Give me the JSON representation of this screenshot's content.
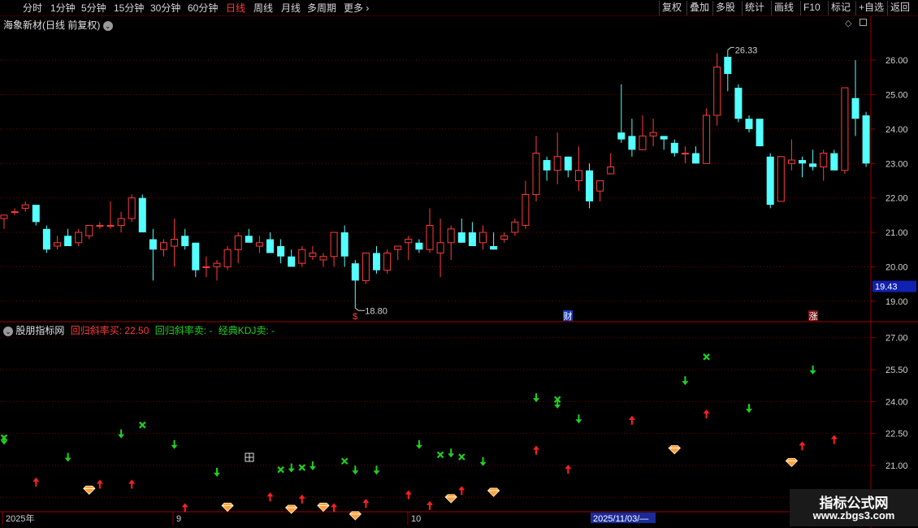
{
  "toolbar": {
    "periods": [
      "分时",
      "1分钟",
      "5分钟",
      "15分钟",
      "30分钟",
      "60分钟",
      "日线",
      "周线",
      "月线",
      "多周期"
    ],
    "active_period": "日线",
    "more": "更多",
    "right_buttons": [
      "复权",
      "叠加",
      "多股",
      "统计",
      "画线",
      "F10",
      "标记",
      "+自选",
      "返回"
    ]
  },
  "main_panel": {
    "title": "海象新材(日线 前复权)",
    "price_axis": [
      "26.00",
      "25.00",
      "24.00",
      "23.00",
      "22.00",
      "21.00",
      "20.00",
      "19.00"
    ],
    "current_price_tag": "19.43",
    "high_label": "26.33",
    "low_label": "18.80",
    "event_markers": [
      "$",
      "财",
      "涨"
    ]
  },
  "indicator_panel": {
    "title": "股朋指标网",
    "label_buy": "回归斜率买: 22.50",
    "label_sell": "回归斜率卖: -",
    "label_kdj": "经典KDJ卖: -",
    "axis": [
      "27.00",
      "25.50",
      "24.00",
      "22.50",
      "21.00",
      "19.50"
    ]
  },
  "date_axis": {
    "labels": [
      "2025年",
      "9",
      "10"
    ],
    "cursor_date": "2025/11/03/—"
  },
  "watermark": {
    "title": "指标公式网",
    "url": "www.zbgs3.com"
  },
  "colors": {
    "up": "#ff3c3c",
    "down": "#54ffff",
    "grid": "#7a0000",
    "buy_arrow": "#ff2020",
    "sell_arrow": "#20d020",
    "diamond": "#ffa040"
  },
  "chart_data": {
    "type": "candlestick",
    "series": [
      {
        "ohlc": [
          [
            21.4,
            21.5,
            21.1,
            21.5
          ],
          [
            21.6,
            21.7,
            21.5,
            21.6
          ],
          [
            21.7,
            21.9,
            21.6,
            21.8
          ],
          [
            21.8,
            21.8,
            21.2,
            21.3
          ],
          [
            21.1,
            21.2,
            20.4,
            20.5
          ],
          [
            20.6,
            20.9,
            20.5,
            20.7
          ],
          [
            20.9,
            21.1,
            20.6,
            20.6
          ],
          [
            20.7,
            21.1,
            20.6,
            21.0
          ],
          [
            20.9,
            21.2,
            20.8,
            21.2
          ],
          [
            21.2,
            21.3,
            21.1,
            21.2
          ],
          [
            21.2,
            21.9,
            21.1,
            21.2
          ],
          [
            21.2,
            21.6,
            21.0,
            21.4
          ],
          [
            21.4,
            22.1,
            21.3,
            22.0
          ],
          [
            22.0,
            22.1,
            21.0,
            21.0
          ],
          [
            20.8,
            21.1,
            19.6,
            20.5
          ],
          [
            20.5,
            20.8,
            20.3,
            20.7
          ],
          [
            20.6,
            21.4,
            20.0,
            20.8
          ],
          [
            20.9,
            21.1,
            20.5,
            20.6
          ],
          [
            20.7,
            20.7,
            19.7,
            19.9
          ],
          [
            20.0,
            20.3,
            19.7,
            20.0
          ],
          [
            20.0,
            20.2,
            19.6,
            20.1
          ],
          [
            20.0,
            20.6,
            19.9,
            20.5
          ],
          [
            20.5,
            21.0,
            20.1,
            20.9
          ],
          [
            20.9,
            21.1,
            20.8,
            20.7
          ],
          [
            20.6,
            20.9,
            20.4,
            20.7
          ],
          [
            20.8,
            21.0,
            20.4,
            20.4
          ],
          [
            20.6,
            20.8,
            20.1,
            20.3
          ],
          [
            20.3,
            20.5,
            20.0,
            20.0
          ],
          [
            20.1,
            20.6,
            20.0,
            20.5
          ],
          [
            20.3,
            20.6,
            20.2,
            20.4
          ],
          [
            20.2,
            20.4,
            20.0,
            20.3
          ],
          [
            20.3,
            21.0,
            20.0,
            21.0
          ],
          [
            21.0,
            21.2,
            20.0,
            20.3
          ],
          [
            20.1,
            20.2,
            18.8,
            19.6
          ],
          [
            19.6,
            20.4,
            19.5,
            20.4
          ],
          [
            20.4,
            20.6,
            19.8,
            19.9
          ],
          [
            19.9,
            20.5,
            19.8,
            20.4
          ],
          [
            20.5,
            20.6,
            20.2,
            20.6
          ],
          [
            20.7,
            20.9,
            20.2,
            20.8
          ],
          [
            20.7,
            20.8,
            20.4,
            20.5
          ],
          [
            20.5,
            21.7,
            20.4,
            21.2
          ],
          [
            20.4,
            21.4,
            19.7,
            20.7
          ],
          [
            20.7,
            21.2,
            20.2,
            21.1
          ],
          [
            21.0,
            21.4,
            20.7,
            20.7
          ],
          [
            21.0,
            21.3,
            20.6,
            20.6
          ],
          [
            20.7,
            21.2,
            20.5,
            21.0
          ],
          [
            20.6,
            21.0,
            20.5,
            20.5
          ],
          [
            20.8,
            21.0,
            20.7,
            20.9
          ],
          [
            21.0,
            21.4,
            20.9,
            21.3
          ],
          [
            21.2,
            22.5,
            21.1,
            22.1
          ],
          [
            22.1,
            23.8,
            21.9,
            23.3
          ],
          [
            23.1,
            23.2,
            22.5,
            22.8
          ],
          [
            22.8,
            23.9,
            22.4,
            23.2
          ],
          [
            23.2,
            23.2,
            22.6,
            22.8
          ],
          [
            22.5,
            23.5,
            22.2,
            22.8
          ],
          [
            22.8,
            23.0,
            21.7,
            21.9
          ],
          [
            22.2,
            22.5,
            21.9,
            22.5
          ],
          [
            22.7,
            23.3,
            22.7,
            22.9
          ],
          [
            23.9,
            25.3,
            23.6,
            23.7
          ],
          [
            23.8,
            24.3,
            23.2,
            23.4
          ],
          [
            23.4,
            24.4,
            23.4,
            23.8
          ],
          [
            23.8,
            24.3,
            23.5,
            23.9
          ],
          [
            23.8,
            23.8,
            23.4,
            23.7
          ],
          [
            23.6,
            23.7,
            23.2,
            23.3
          ],
          [
            23.3,
            23.5,
            23.0,
            23.3
          ],
          [
            23.3,
            23.5,
            23.0,
            23.0
          ],
          [
            23.0,
            24.6,
            23.0,
            24.4
          ],
          [
            24.4,
            26.2,
            24.1,
            25.8
          ],
          [
            26.1,
            26.3,
            25.1,
            25.6
          ],
          [
            25.2,
            25.3,
            24.2,
            24.3
          ],
          [
            24.3,
            24.4,
            23.9,
            24.0
          ],
          [
            24.3,
            24.3,
            23.5,
            23.5
          ],
          [
            23.2,
            23.3,
            21.7,
            21.8
          ],
          [
            21.9,
            23.1,
            21.9,
            23.2
          ],
          [
            23.0,
            23.7,
            22.8,
            23.1
          ],
          [
            23.1,
            23.2,
            22.6,
            23.0
          ],
          [
            23.0,
            23.4,
            22.8,
            22.9
          ],
          [
            22.9,
            23.4,
            22.5,
            23.3
          ],
          [
            23.3,
            23.4,
            22.8,
            22.8
          ],
          [
            22.8,
            25.2,
            22.7,
            25.2
          ],
          [
            24.9,
            26.0,
            23.8,
            24.3
          ],
          [
            24.4,
            24.5,
            22.9,
            23.0
          ]
        ]
      }
    ],
    "ylim": [
      18.5,
      26.9
    ],
    "indicator_ylim": [
      18.9,
      27.6
    ],
    "indicator_signals": [
      {
        "i": 0,
        "type": "cross",
        "v": 22.3
      },
      {
        "i": 0,
        "type": "sell",
        "v": 22.2
      },
      {
        "i": 3,
        "type": "buy",
        "v": 20.2
      },
      {
        "i": 6,
        "type": "sell",
        "v": 21.4
      },
      {
        "i": 8,
        "type": "diamond",
        "v": 19.8
      },
      {
        "i": 9,
        "type": "buy",
        "v": 20.1
      },
      {
        "i": 11,
        "type": "sell",
        "v": 22.5
      },
      {
        "i": 12,
        "type": "buy",
        "v": 20.1
      },
      {
        "i": 13,
        "type": "cross",
        "v": 22.9
      },
      {
        "i": 16,
        "type": "sell",
        "v": 22.0
      },
      {
        "i": 17,
        "type": "buy",
        "v": 19.0
      },
      {
        "i": 20,
        "type": "sell",
        "v": 20.7
      },
      {
        "i": 21,
        "type": "diamond",
        "v": 19.0
      },
      {
        "i": 25,
        "type": "buy",
        "v": 19.5
      },
      {
        "i": 26,
        "type": "cross",
        "v": 20.8
      },
      {
        "i": 27,
        "type": "sell",
        "v": 20.9
      },
      {
        "i": 27,
        "type": "diamond",
        "v": 18.9
      },
      {
        "i": 28,
        "type": "buy",
        "v": 19.4
      },
      {
        "i": 28,
        "type": "cross",
        "v": 20.9
      },
      {
        "i": 29,
        "type": "sell",
        "v": 21.0
      },
      {
        "i": 30,
        "type": "diamond",
        "v": 19.0
      },
      {
        "i": 31,
        "type": "buy",
        "v": 19.0
      },
      {
        "i": 32,
        "type": "cross",
        "v": 21.2
      },
      {
        "i": 33,
        "type": "sell",
        "v": 20.8
      },
      {
        "i": 33,
        "type": "diamond",
        "v": 18.6
      },
      {
        "i": 34,
        "type": "buy",
        "v": 19.2
      },
      {
        "i": 35,
        "type": "sell",
        "v": 20.8
      },
      {
        "i": 38,
        "type": "buy",
        "v": 19.6
      },
      {
        "i": 39,
        "type": "sell",
        "v": 22.0
      },
      {
        "i": 40,
        "type": "buy",
        "v": 19.1
      },
      {
        "i": 41,
        "type": "cross",
        "v": 21.5
      },
      {
        "i": 42,
        "type": "diamond",
        "v": 19.4
      },
      {
        "i": 42,
        "type": "sell",
        "v": 21.6
      },
      {
        "i": 43,
        "type": "cross",
        "v": 21.4
      },
      {
        "i": 43,
        "type": "buy",
        "v": 19.8
      },
      {
        "i": 45,
        "type": "sell",
        "v": 21.2
      },
      {
        "i": 46,
        "type": "diamond",
        "v": 19.7
      },
      {
        "i": 50,
        "type": "buy",
        "v": 21.7
      },
      {
        "i": 50,
        "type": "sell",
        "v": 24.2
      },
      {
        "i": 52,
        "type": "cross",
        "v": 24.1
      },
      {
        "i": 52,
        "type": "sell",
        "v": 23.9
      },
      {
        "i": 53,
        "type": "buy",
        "v": 20.8
      },
      {
        "i": 54,
        "type": "sell",
        "v": 23.2
      },
      {
        "i": 59,
        "type": "buy",
        "v": 23.1
      },
      {
        "i": 63,
        "type": "diamond",
        "v": 21.7
      },
      {
        "i": 64,
        "type": "sell",
        "v": 25.0
      },
      {
        "i": 66,
        "type": "cross",
        "v": 26.1
      },
      {
        "i": 66,
        "type": "buy",
        "v": 23.4
      },
      {
        "i": 70,
        "type": "sell",
        "v": 23.7
      },
      {
        "i": 74,
        "type": "diamond",
        "v": 21.1
      },
      {
        "i": 75,
        "type": "buy",
        "v": 21.9
      },
      {
        "i": 76,
        "type": "sell",
        "v": 25.5
      },
      {
        "i": 78,
        "type": "buy",
        "v": 22.2
      }
    ]
  }
}
